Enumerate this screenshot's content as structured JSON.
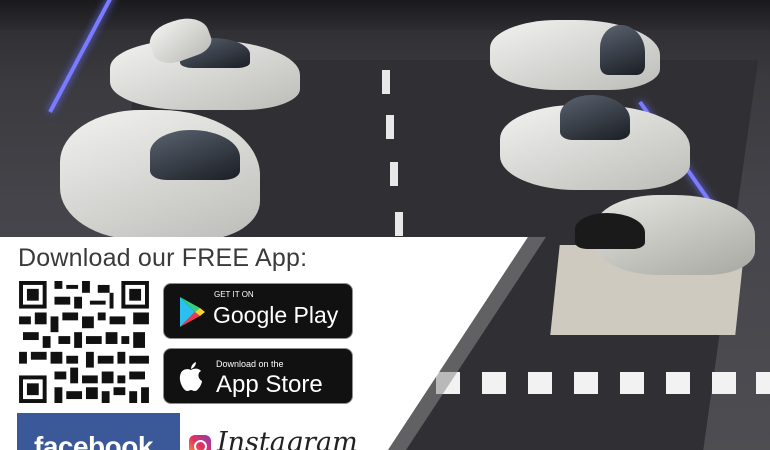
{
  "promo": {
    "headline": "Download our FREE App:"
  },
  "google_play": {
    "small_label": "GET IT ON",
    "large_label": "Google Play",
    "icon": "google-play-icon"
  },
  "app_store": {
    "small_label": "Download on the",
    "large_label": "App Store",
    "icon": "apple-icon"
  },
  "social": {
    "facebook_label": "facebook",
    "instagram_label": "Instagram",
    "facebook_color": "#3b5998"
  },
  "colors": {
    "headline": "#3a3a3a",
    "badge_background": "#111111",
    "runway_light": "#7a7cff"
  }
}
